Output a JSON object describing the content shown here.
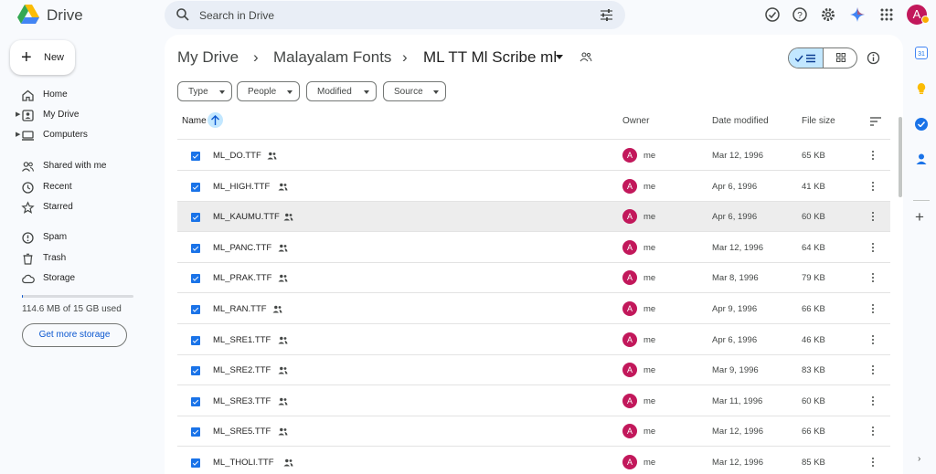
{
  "app": {
    "title": "Drive"
  },
  "search": {
    "placeholder": "Search in Drive"
  },
  "user": {
    "avatar_letter": "A"
  },
  "sidebar": {
    "new_label": "New",
    "items": [
      {
        "label": "Home",
        "icon": "home-icon"
      },
      {
        "label": "My Drive",
        "icon": "my-drive-icon"
      },
      {
        "label": "Computers",
        "icon": "computer-icon"
      },
      {
        "label": "Shared with me",
        "icon": "people-icon"
      },
      {
        "label": "Recent",
        "icon": "clock-icon"
      },
      {
        "label": "Starred",
        "icon": "star-icon"
      },
      {
        "label": "Spam",
        "icon": "spam-icon"
      },
      {
        "label": "Trash",
        "icon": "trash-icon"
      },
      {
        "label": "Storage",
        "icon": "cloud-icon"
      }
    ],
    "storage_text": "114.6 MB of 15 GB used",
    "storage_fraction": 0.0075,
    "get_storage_label": "Get more storage"
  },
  "breadcrumb": {
    "items": [
      "My Drive",
      "Malayalam Fonts",
      "ML TT Ml Scribe ml"
    ],
    "separator": "›"
  },
  "filters": [
    "Type",
    "People",
    "Modified",
    "Source"
  ],
  "table": {
    "columns": {
      "name": "Name",
      "owner": "Owner",
      "date": "Date modified",
      "size": "File size"
    },
    "rows": [
      {
        "name": "ML_DO.TTF",
        "owner": "me",
        "date": "Mar 12, 1996",
        "size": "65 KB",
        "selected": false
      },
      {
        "name": "ML_HIGH.TTF",
        "owner": "me",
        "date": "Apr 6, 1996",
        "size": "41 KB",
        "selected": false
      },
      {
        "name": "ML_KAUMU.TTF",
        "owner": "me",
        "date": "Apr 6, 1996",
        "size": "60 KB",
        "selected": true
      },
      {
        "name": "ML_PANC.TTF",
        "owner": "me",
        "date": "Mar 12, 1996",
        "size": "64 KB",
        "selected": false
      },
      {
        "name": "ML_PRAK.TTF",
        "owner": "me",
        "date": "Mar 8, 1996",
        "size": "79 KB",
        "selected": false
      },
      {
        "name": "ML_RAN.TTF",
        "owner": "me",
        "date": "Apr 9, 1996",
        "size": "66 KB",
        "selected": false
      },
      {
        "name": "ML_SRE1.TTF",
        "owner": "me",
        "date": "Apr 6, 1996",
        "size": "46 KB",
        "selected": false
      },
      {
        "name": "ML_SRE2.TTF",
        "owner": "me",
        "date": "Mar 9, 1996",
        "size": "83 KB",
        "selected": false
      },
      {
        "name": "ML_SRE3.TTF",
        "owner": "me",
        "date": "Mar 11, 1996",
        "size": "60 KB",
        "selected": false
      },
      {
        "name": "ML_SRE5.TTF",
        "owner": "me",
        "date": "Mar 12, 1996",
        "size": "66 KB",
        "selected": false
      },
      {
        "name": "ML_THOLI.TTF",
        "owner": "me",
        "date": "Mar 12, 1996",
        "size": "85 KB",
        "selected": false
      }
    ]
  },
  "colors": {
    "accent": "#0b57d0",
    "avatar": "#c2185b",
    "file_icon": "#1a73e8",
    "selected_row": "#ededed",
    "chip_active": "#c2e7ff"
  }
}
